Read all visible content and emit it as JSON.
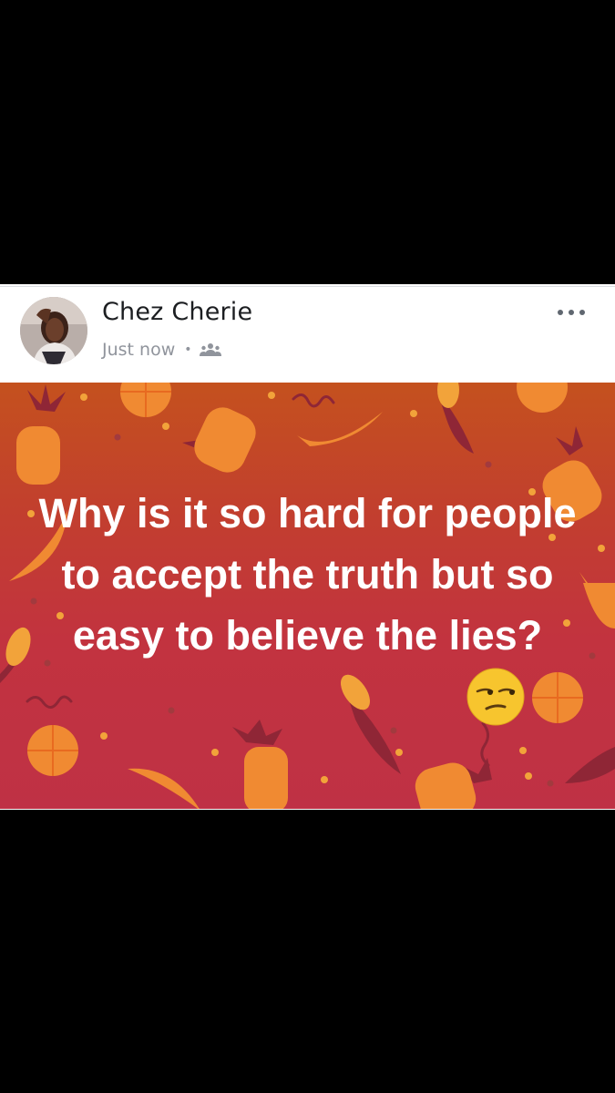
{
  "post": {
    "author": "Chez Cherie",
    "timestamp": "Just now",
    "separator": "•",
    "audience_icon": "friends-icon",
    "more_icon": "more-horizontal-icon",
    "text": "Why is it so hard for people to accept the truth but so easy to believe the lies?",
    "emoji": "unamused-face-icon"
  },
  "colors": {
    "background": "#000000",
    "card": "#ffffff",
    "name_text": "#1c1e21",
    "meta_text": "#90949c",
    "image_top": "#c4511e",
    "image_bottom": "#bf3145",
    "fruit_orange": "#f08a32",
    "leaf_maroon": "#8f2636"
  }
}
